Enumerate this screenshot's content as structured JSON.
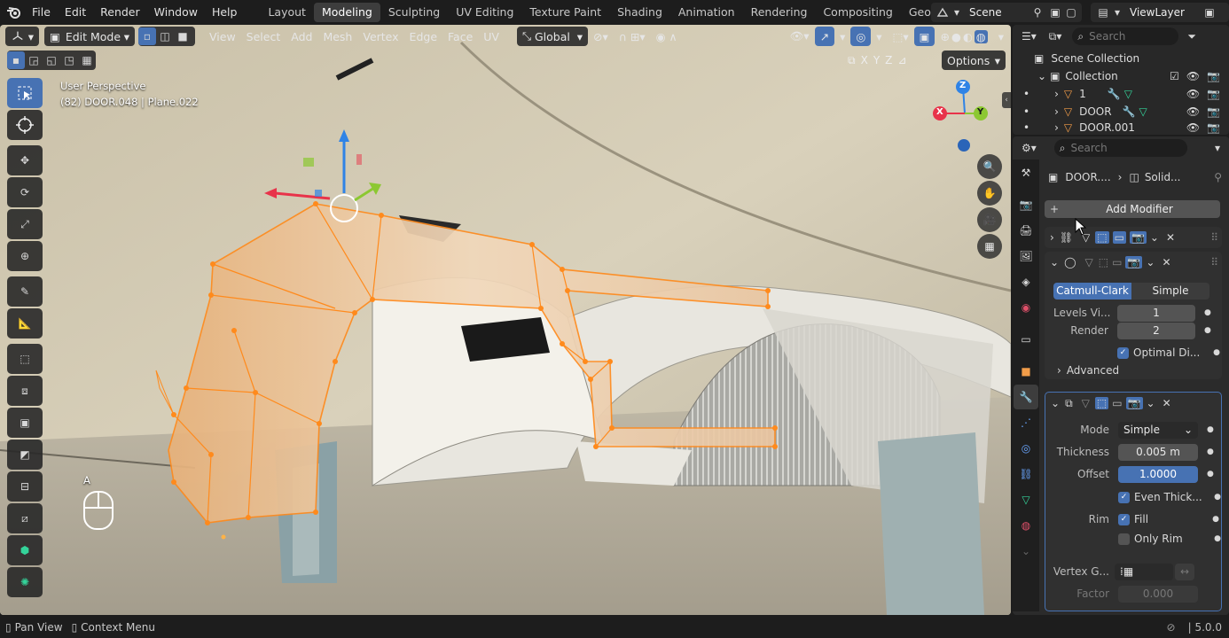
{
  "topbar": {
    "menus": [
      "File",
      "Edit",
      "Render",
      "Window",
      "Help"
    ],
    "workspaces": [
      "Layout",
      "Modeling",
      "Sculpting",
      "UV Editing",
      "Texture Paint",
      "Shading",
      "Animation",
      "Rendering",
      "Compositing",
      "Geometry Nodes"
    ],
    "active_workspace": "Modeling",
    "scene": "Scene",
    "view_layer": "ViewLayer"
  },
  "viewport_header": {
    "mode": "Edit Mode",
    "menus": [
      "View",
      "Select",
      "Add",
      "Mesh",
      "Vertex",
      "Edge",
      "Face",
      "UV"
    ],
    "orientation": "Global",
    "options": "Options",
    "axes": [
      "X",
      "Y",
      "Z"
    ]
  },
  "viewport": {
    "perspective": "User Perspective",
    "object_info": "(82) DOOR.048 | Plane.022",
    "key_hint": "A",
    "gizmo_axes": [
      "X",
      "Y",
      "Z"
    ]
  },
  "outliner": {
    "search_placeholder": "Search",
    "scene_collection": "Scene Collection",
    "collection": "Collection",
    "items": [
      "1",
      "DOOR",
      "DOOR.001"
    ]
  },
  "properties": {
    "search_placeholder": "Search",
    "breadcrumb_object": "DOOR....",
    "breadcrumb_modifier": "Solid...",
    "add_modifier": "Add Modifier",
    "subdivision": {
      "methods": [
        "Catmull-Clark",
        "Simple"
      ],
      "active_method": "Catmull-Clark",
      "levels_label": "Levels Vi...",
      "levels_value": "1",
      "render_label": "Render",
      "render_value": "2",
      "optimal_display": "Optimal Di...",
      "advanced": "Advanced"
    },
    "solidify": {
      "mode_label": "Mode",
      "mode_value": "Simple",
      "thickness_label": "Thickness",
      "thickness_value": "0.005 m",
      "offset_label": "Offset",
      "offset_value": "1.0000",
      "even_thickness": "Even Thick...",
      "rim_label": "Rim",
      "fill": "Fill",
      "only_rim": "Only Rim",
      "vertex_group_label": "Vertex G...",
      "factor_label": "Factor",
      "factor_value": "0.000"
    }
  },
  "statusbar": {
    "left_hint": "Pan View",
    "context_hint": "Context Menu",
    "version": "5.0.0"
  },
  "colors": {
    "accent": "#4772b3",
    "selection_orange": "#ff8a1c",
    "axis_x": "#e8334a",
    "axis_y": "#8cc832",
    "axis_z": "#2f83e6"
  }
}
